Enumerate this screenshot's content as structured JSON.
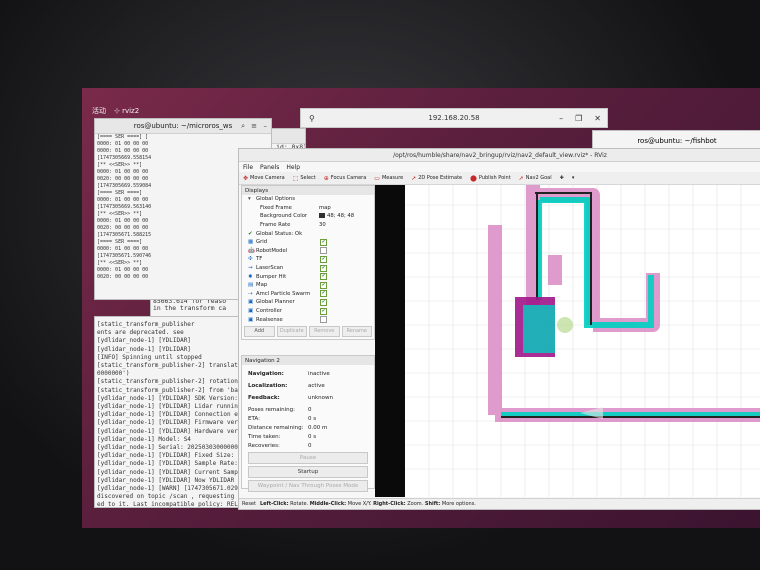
{
  "desktop": {
    "activities": "活动",
    "app_name": "rviz2"
  },
  "vnc": {
    "address": "192.168.20.58"
  },
  "term1": {
    "title": "ros@ubuntu: ~/microros_ws",
    "lines": [
      "[==== SER ====]      ] [",
      "0000: 01 00 00 00 02 01 00 0",
      "0000: 01 00 00 00 00 00 02 0",
      "[1747305669.558154] debug",
      "[** <<SER>> **]",
      "0000: 01 00 00 00 00 00 00 0",
      "0020: 00 00 00 00",
      "[1747305669.559084] debug",
      "[==== SER ====]",
      "0000: 01 00 00 00 02 01 00 0",
      "[1747305669.563140] debug",
      "[** <<SER>> **]",
      "0000: 01 00 00 00 01 0C 00 0",
      "0020: 00 00 00 00",
      "[1747305671.588215] debug",
      "[==== SER ====]",
      "0000: 01 00 00 00 02 01 00 0",
      "[1747305671.590746] debug",
      "[** <<SER>> **]",
      "0000: 01 00 00 00 01 0C 00 0",
      "0020: 00 00 00 00"
    ]
  },
  "term2": {
    "lines": [
      "[static_transform_publisher",
      "ents are deprecated. see",
      "[ydlidar_node-1] [YDLIDAR]",
      "[ydlidar_node-1] [YDLIDAR]",
      "[INFO] Spinning until stopped",
      "[static_transform_publisher-2] translation: ('0.000000'",
      "0000000')",
      "[static_transform_publisher-2] rotation: ('0.000000'",
      "[static_transform_publisher-2] from 'base_link' to 'l",
      "[ydlidar_node-1] [YDLIDAR] SDK Version: 1.4.5",
      "[ydlidar_node-1] [YDLIDAR] Lidar running correctly !",
      "[ydlidar_node-1] [YDLIDAR] Connection established in",
      "[ydlidar_node-1] [YDLIDAR] Firmware version: 0.3",
      "[ydlidar_node-1] [YDLIDAR] Hardware version: 2",
      "[ydlidar_node-1] Model: S4",
      "[ydlidar_node-1] Serial: 2025030300000000",
      "[ydlidar_node-1] [YDLIDAR] Fixed Size: 500",
      "[ydlidar_node-1] [YDLIDAR] Sample Rate: 3K",
      "[ydlidar_node-1] [YDLIDAR] Current Sampling Rate",
      "[ydlidar_node-1] [YDLIDAR] Now YDLIDAR is scanni",
      "[ydlidar_node-1] [WARN] [1747305671.029513868] [ydlid",
      "discovered on topic /scan , requesting incompatibl",
      "ed to it. Last incompatible policy: RELIABILITY_QOS_P"
    ]
  },
  "term3": {
    "lines": [
      "client key: 0x56F07352, session_id: 0x81",
      "cal_costmap]: Messa",
      "85660.262 for reaso",
      "in the transform ca",
      "[component_containe",
      "cal_costmap]: Messa",
      "85660.262 for reaso",
      "in the transform ca",
      "[component_containe",
      "lobal_costmap]: Mes",
      "7385660.262 for rea",
      "a in the transform",
      "[component_containe",
      "lobal_costmap]: Mes",
      "7385663.614 for rea",
      "a in the transform c",
      "[component_containe",
      "cal_costmap]: Messa",
      "85663.614 for reaso",
      "in the transform ca",
      "[component_containe",
      "cal_costmap]: Messa",
      "85663.614 for reaso",
      "in the transform ca"
    ]
  },
  "ssh": {
    "title": "ros@ubuntu: ~/fishbot"
  },
  "rviz": {
    "title": "/opt/ros/humble/share/nav2_bringup/rviz/nav2_default_view.rviz* - RViz",
    "menu": [
      "File",
      "Panels",
      "Help"
    ],
    "tools": [
      "Move Camera",
      "Select",
      "Focus Camera",
      "Measure",
      "2D Pose Estimate",
      "Publish Point",
      "Nav2 Goal"
    ],
    "displays": {
      "header": "Displays",
      "global_options": "Global Options",
      "fixed_frame_label": "Fixed Frame",
      "fixed_frame_value": "map",
      "bg_color_label": "Background Color",
      "bg_color_value": "48; 48; 48",
      "frame_rate_label": "Frame Rate",
      "frame_rate_value": "30",
      "global_status": "Global Status: Ok",
      "items": [
        {
          "name": "Grid",
          "checked": true
        },
        {
          "name": "RobotModel",
          "checked": false
        },
        {
          "name": "TF",
          "checked": true
        },
        {
          "name": "LaserScan",
          "checked": true
        },
        {
          "name": "Bumper Hit",
          "checked": true
        },
        {
          "name": "Map",
          "checked": true
        },
        {
          "name": "Amcl Particle Swarm",
          "checked": true
        },
        {
          "name": "Global Planner",
          "checked": true
        },
        {
          "name": "Controller",
          "checked": true
        },
        {
          "name": "Realsense",
          "checked": false
        }
      ],
      "buttons": [
        "Add",
        "Duplicate",
        "Remove",
        "Rename"
      ]
    },
    "nav2": {
      "header": "Navigation 2",
      "navigation_label": "Navigation:",
      "navigation_value": "inactive",
      "localization_label": "Localization:",
      "localization_value": "active",
      "feedback_label": "Feedback:",
      "feedback_value": "unknown",
      "poses_label": "Poses remaining:",
      "poses_value": "0",
      "eta_label": "ETA:",
      "eta_value": "0 s",
      "distance_label": "Distance remaining:",
      "distance_value": "0.00 m",
      "time_label": "Time taken:",
      "time_value": "0 s",
      "recoveries_label": "Recoveries:",
      "recoveries_value": "0",
      "pause": "Pause",
      "startup": "Startup",
      "waypoint": "Waypoint / Nav Through Poses Mode"
    },
    "status": {
      "reset": "Reset",
      "left": "Left-Click:",
      "left_val": "Rotate.",
      "middle": "Middle-Click:",
      "middle_val": "Move X/Y.",
      "right": "Right-Click:",
      "right_val": "Zoom.",
      "shift": "Shift:",
      "shift_val": "More options."
    },
    "colors": {
      "costmap_inflation": "#d98ac4",
      "costmap_lethal": "#a0168a",
      "laser": "#00d0c0",
      "walls": "#222222"
    }
  }
}
